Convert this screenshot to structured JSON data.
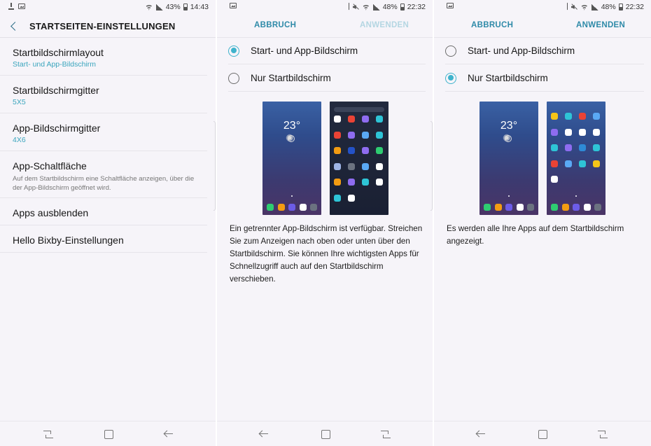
{
  "screen1": {
    "status": {
      "battery": "43%",
      "time": "14:43"
    },
    "title": "STARTSEITEN-EINSTELLUNGEN",
    "items": [
      {
        "title": "Startbildschirmlayout",
        "sub": "Start- und App-Bildschirm"
      },
      {
        "title": "Startbildschirmgitter",
        "sub": "5X5"
      },
      {
        "title": "App-Bildschirmgitter",
        "sub": "4X6"
      },
      {
        "title": "App-Schaltfläche",
        "desc": "Auf dem Startbildschirm eine Schaltfläche anzeigen, über die der App-Bildschirm geöffnet wird."
      },
      {
        "title": "Apps ausblenden"
      },
      {
        "title": "Hello Bixby-Einstellungen"
      }
    ]
  },
  "screen2": {
    "status": {
      "battery": "48%",
      "time": "22:32"
    },
    "cancel": "ABBRUCH",
    "apply": "ANWENDEN",
    "options": [
      "Start- und App-Bildschirm",
      "Nur Startbildschirm"
    ],
    "selected": 0,
    "clock": "23°",
    "description": "Ein getrennter App-Bildschirm ist verfügbar. Streichen Sie zum Anzeigen nach oben oder unten über den Startbildschirm. Sie können Ihre wichtigsten Apps für Schnellzugriff auch auf den Startbildschirm verschieben."
  },
  "screen3": {
    "status": {
      "battery": "48%",
      "time": "22:32"
    },
    "cancel": "ABBRUCH",
    "apply": "ANWENDEN",
    "options": [
      "Start- und App-Bildschirm",
      "Nur Startbildschirm"
    ],
    "selected": 1,
    "clock": "23°",
    "description": "Es werden alle Ihre Apps auf dem Startbildschirm angezeigt."
  },
  "colors": {
    "accent": "#3fb3cc",
    "button": "#2e8aa8",
    "button_disabled": "#b4d6e2",
    "dock": [
      "#2ecc71",
      "#f39c12",
      "#6c5ce7",
      "#ffffff",
      "#6b7280"
    ],
    "apps_grid_1": [
      "#ffffff",
      "#ea4335",
      "#8e6cf0",
      "#2ec4d6",
      "#ea4335",
      "#8e6cf0",
      "#5aa9f5",
      "#2ec4d6",
      "#f39c12",
      "#2452c7",
      "#8e6cf0",
      "#2ecc71",
      "#9fb5e6",
      "#6b7280",
      "#5aa9f5",
      "#ffffff",
      "#f39c12",
      "#8e6cf0",
      "#2ec4d6",
      "#ffffff",
      "#2ec4d6",
      "#ffffff"
    ],
    "apps_grid_2": [
      "#f5c518",
      "#2ec4d6",
      "#ea4335",
      "#5aa9f5",
      "#8e6cf0",
      "#ffffff",
      "#ffffff",
      "#ffffff",
      "#2ec4d6",
      "#8e6cf0",
      "#2e8ad6",
      "#2ec4d6",
      "#ea4335",
      "#5aa9f5",
      "#2ec4d6",
      "#f5c518",
      "#ffffff"
    ]
  }
}
